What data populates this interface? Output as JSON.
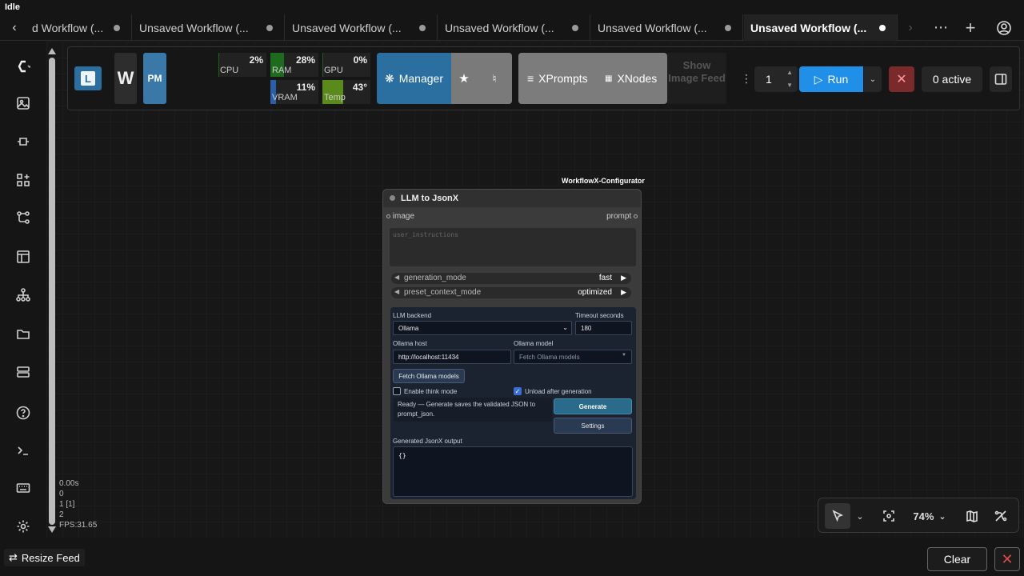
{
  "app": {
    "title": "Idle"
  },
  "tabs": [
    {
      "label": "d Workflow (..."
    },
    {
      "label": "Unsaved Workflow (..."
    },
    {
      "label": "Unsaved Workflow (..."
    },
    {
      "label": "Unsaved Workflow (..."
    },
    {
      "label": "Unsaved Workflow (..."
    },
    {
      "label": "Unsaved Workflow (..."
    }
  ],
  "active_tab_index": 5,
  "tabbar_icons": {
    "back": "chevron-left-icon",
    "forward": "chevron-right-icon",
    "more": "ellipsis-icon",
    "add": "plus-icon",
    "user": "user-icon"
  },
  "sidebar": {
    "items": [
      {
        "icon": "comfy-logo-icon"
      },
      {
        "icon": "images-icon"
      },
      {
        "icon": "model-library-icon"
      },
      {
        "icon": "node-library-icon"
      },
      {
        "icon": "workflows-icon"
      },
      {
        "icon": "templates-icon"
      },
      {
        "icon": "network-icon"
      },
      {
        "icon": "folder-icon"
      },
      {
        "icon": "queue-icon"
      },
      {
        "icon": "help-icon"
      },
      {
        "icon": "terminal-icon"
      },
      {
        "icon": "keyboard-icon"
      },
      {
        "icon": "settings-icon"
      }
    ]
  },
  "toolbar": {
    "w_label": "W",
    "pm_label": "PM",
    "meters": {
      "cpu": {
        "name": "CPU",
        "value": "2%",
        "level": 0.02
      },
      "ram": {
        "name": "RAM",
        "value": "28%",
        "level": 0.28
      },
      "gpu": {
        "name": "GPU",
        "value": "0%",
        "level": 0.0
      },
      "vram": {
        "name": "VRAM",
        "value": "11%",
        "level": 0.11
      },
      "temp": {
        "name": "Temp",
        "value": "43°",
        "level": 0.43
      }
    },
    "manager_label": "Manager",
    "xprompts_label": "XPrompts",
    "xnodes_label": "XNodes",
    "show_feed_label": "Show Image Feed",
    "run_count": "1",
    "run_label": "Run",
    "active_label": "0 active"
  },
  "node": {
    "tag": "WorkflowX-Configurator",
    "title": "LLM to JsonX",
    "input_slot": "image",
    "output_slot": "prompt",
    "instructions_placeholder": "user_instructions",
    "widgets": [
      {
        "name": "generation_mode",
        "value": "fast"
      },
      {
        "name": "preset_context_mode",
        "value": "optimized"
      }
    ],
    "panel": {
      "llm_backend_label": "LLM backend",
      "llm_backend_value": "Ollama",
      "timeout_label": "Timeout seconds",
      "timeout_value": "180",
      "host_label": "Ollama host",
      "host_value": "http://localhost:11434",
      "model_label": "Ollama model",
      "model_placeholder": "Fetch Ollama models",
      "fetch_button": "Fetch Ollama models",
      "think_label": "Enable think mode",
      "think_checked": false,
      "unload_label": "Unload after generation",
      "unload_checked": true,
      "status": "Ready — Generate saves the validated JSON to prompt_json.",
      "generate_button": "Generate",
      "settings_button": "Settings",
      "output_label": "Generated JsonX output",
      "output_value": "{}"
    }
  },
  "stats": [
    "0.00s",
    "0",
    "1 [1]",
    "2",
    "FPS:31.65"
  ],
  "canvas_controls": {
    "zoom": "74%"
  },
  "footer": {
    "resize_feed_label": "Resize Feed",
    "clear_label": "Clear"
  }
}
